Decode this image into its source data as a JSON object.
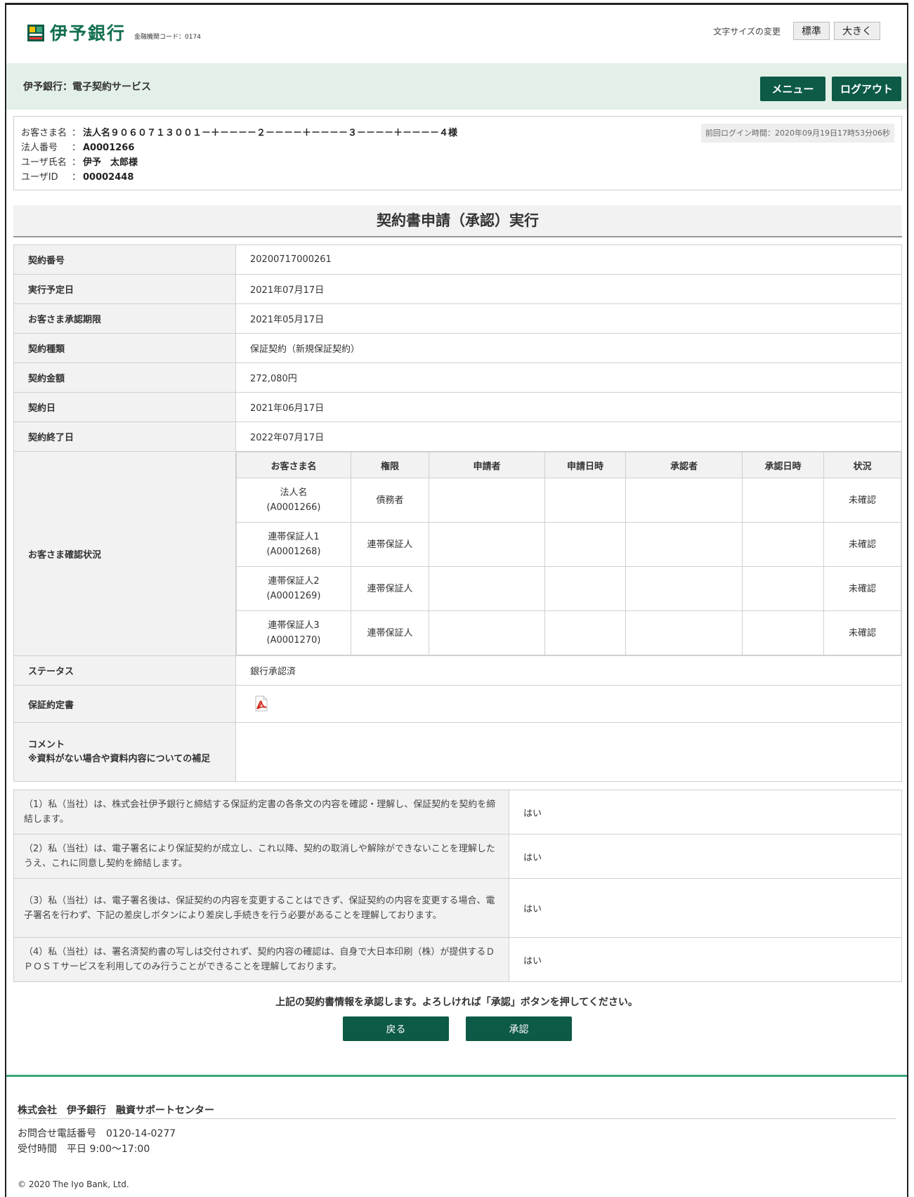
{
  "header": {
    "logo_text": "伊予銀行",
    "bank_code": "金融機関コード：0174",
    "font_size_label": "文字サイズの変更",
    "font_standard": "標準",
    "font_large": "大きく",
    "service_title": "伊予銀行：電子契約サービス",
    "menu_label": "メニュー",
    "logout_label": "ログアウト"
  },
  "user": {
    "customer_label": "お客さま名",
    "customer_value": "法人名９０６０７１３００１－＋－－－－２－－－－＋－－－－３－－－－＋－－－－４様",
    "corp_label": "法人番号",
    "corp_value": "A0001266",
    "user_label": "ユーザ氏名",
    "user_value": "伊予　太郎様",
    "id_label": "ユーザID",
    "id_value": "00002448",
    "colon": "：",
    "last_login": "前回ログイン時間：2020年09月19日17時53分06秒"
  },
  "page_title": "契約書申請（承認）実行",
  "contract": {
    "number_label": "契約番号",
    "number": "20200717000261",
    "exec_date_label": "実行予定日",
    "exec_date": "2021年07月17日",
    "deadline_label": "お客さま承認期限",
    "deadline": "2021年05月17日",
    "type_label": "契約種類",
    "type": "保証契約（新規保証契約）",
    "amount_label": "契約金額",
    "amount": "272,080円",
    "date_label": "契約日",
    "date": "2021年06月17日",
    "end_label": "契約終了日",
    "end": "2022年07月17日",
    "confirm_label": "お客さま確認状況",
    "status_label": "ステータス",
    "status": "銀行承認済",
    "doc_label": "保証約定書",
    "comment_label_1": "コメント",
    "comment_label_2": "※資料がない場合や資料内容についての補足"
  },
  "confirm_table": {
    "headers": [
      "お客さま名",
      "権限",
      "申請者",
      "申請日時",
      "承認者",
      "承認日時",
      "状況"
    ],
    "rows": [
      {
        "name": "法人名",
        "id": "(A0001266)",
        "role": "債務者",
        "applicant": "",
        "applied_at": "",
        "approver": "",
        "approved_at": "",
        "status": "未確認"
      },
      {
        "name": "連帯保証人1",
        "id": "(A0001268)",
        "role": "連帯保証人",
        "applicant": "",
        "applied_at": "",
        "approver": "",
        "approved_at": "",
        "status": "未確認"
      },
      {
        "name": "連帯保証人2",
        "id": "(A0001269)",
        "role": "連帯保証人",
        "applicant": "",
        "applied_at": "",
        "approver": "",
        "approved_at": "",
        "status": "未確認"
      },
      {
        "name": "連帯保証人3",
        "id": "(A0001270)",
        "role": "連帯保証人",
        "applicant": "",
        "applied_at": "",
        "approver": "",
        "approved_at": "",
        "status": "未確認"
      }
    ]
  },
  "agreements": [
    {
      "text": "（1）私（当社）は、株式会社伊予銀行と締結する保証約定書の各条文の内容を確認・理解し、保証契約を契約を締結します。",
      "answer": "はい"
    },
    {
      "text": "（2）私（当社）は、電子署名により保証契約が成立し、これ以降、契約の取消しや解除ができないことを理解したうえ、これに同意し契約を締結します。",
      "answer": "はい"
    },
    {
      "text": "（3）私（当社）は、電子署名後は、保証契約の内容を変更することはできず、保証契約の内容を変更する場合、電子署名を行わず、下記の差戻しボタンにより差戻し手続きを行う必要があることを理解しております。",
      "answer": "はい"
    },
    {
      "text": "（4）私（当社）は、署名済契約書の写しは交付されず、契約内容の確認は、自身で大日本印刷（株）が提供するＤＰＯＳＴサービスを利用してのみ行うことができることを理解しております。",
      "answer": "はい"
    }
  ],
  "confirm_message": "上記の契約書情報を承認します。よろしければ「承認」ボタンを押してください。",
  "buttons": {
    "back": "戻る",
    "approve": "承認"
  },
  "footer": {
    "title": "株式会社　伊予銀行　融資サポートセンター",
    "tel": "お問合せ電話番号　0120-14-0277",
    "hours": "受付時間　平日 9:00～17:00",
    "copyright": "© 2020 The Iyo Bank, Ltd."
  },
  "colors": {
    "brand_green": "#0d5a47",
    "header_band": "#e3f0e8",
    "footer_line": "#3aa57a"
  },
  "icons": {
    "logo": "iyo-bank-logo-icon",
    "pdf": "pdf-icon"
  }
}
